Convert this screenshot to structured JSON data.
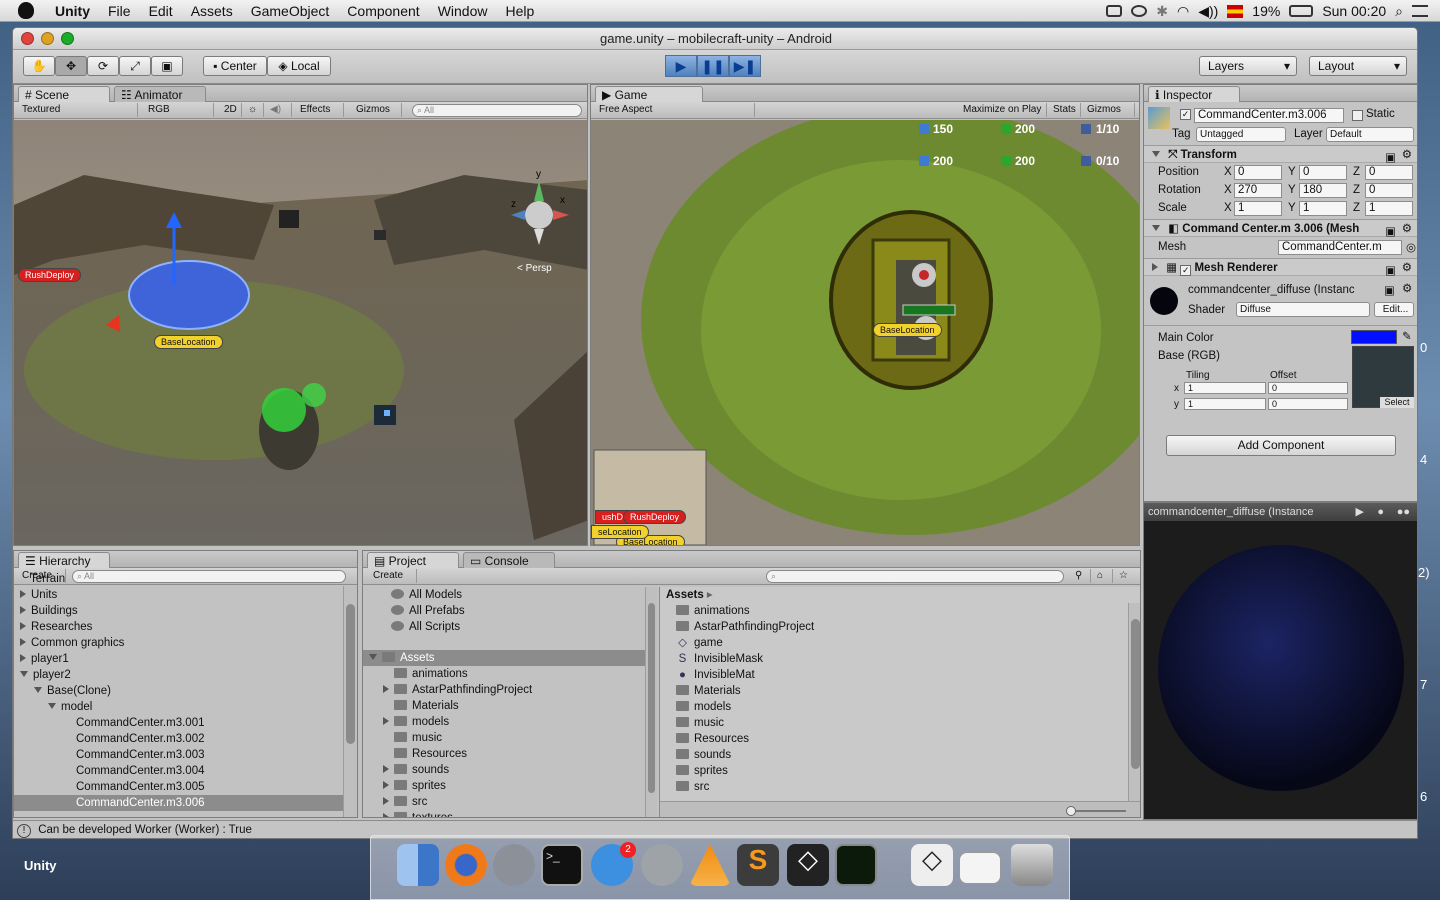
{
  "menubar": {
    "app": "Unity",
    "items": [
      "File",
      "Edit",
      "Assets",
      "GameObject",
      "Component",
      "Window",
      "Help"
    ],
    "battery": "19%",
    "clock": "Sun 00:20"
  },
  "window": {
    "title": "game.unity – mobilecraft-unity – Android"
  },
  "toolbar": {
    "center": "Center",
    "local": "Local",
    "layers": "Layers",
    "layout": "Layout"
  },
  "scene": {
    "tab": "Scene",
    "tab2": "Animator",
    "shading": "Textured",
    "mode": "RGB",
    "two_d": "2D",
    "effects": "Effects",
    "gizmos": "Gizmos",
    "search_placeholder": "All",
    "persp": "< Persp",
    "gizmo_y": "y",
    "gizmo_x": "x",
    "gizmo_z": "z",
    "label_rush": "RushDeploy",
    "label_base": "BaseLocation"
  },
  "game": {
    "tab": "Game",
    "aspect": "Free Aspect",
    "maximize": "Maximize on Play",
    "stats": "Stats",
    "gizmos": "Gizmos",
    "hud": {
      "r1a": "150",
      "r1b": "200",
      "r1c": "1/10",
      "r2a": "200",
      "r2b": "200",
      "r2c": "0/10"
    },
    "base_label": "BaseLocation",
    "mini_rush": "RushDeploy",
    "mini_rush2": "ushDe",
    "mini_base": "BaseLocation",
    "mini_base2": "seLocation"
  },
  "inspector": {
    "tab": "Inspector",
    "object": "CommandCenter.m3.006",
    "static": "Static",
    "tag_label": "Tag",
    "tag": "Untagged",
    "layer_label": "Layer",
    "layer": "Default",
    "transform": "Transform",
    "position_label": "Position",
    "rotation_label": "Rotation",
    "scale_label": "Scale",
    "position": {
      "x": "0",
      "y": "0",
      "z": "0"
    },
    "rotation": {
      "x": "270",
      "y": "180",
      "z": "0"
    },
    "scale": {
      "x": "1",
      "y": "1",
      "z": "1"
    },
    "axis_x": "X",
    "axis_y": "Y",
    "axis_z": "Z",
    "mesh_filter": "Command Center.m 3.006 (Mesh",
    "mesh_label": "Mesh",
    "mesh_value": "CommandCenter.m",
    "mesh_renderer": "Mesh Renderer",
    "material": "commandcenter_diffuse (Instanc",
    "shader_label": "Shader",
    "shader": "Diffuse",
    "edit": "Edit...",
    "main_color": "Main Color",
    "base_rgb": "Base (RGB)",
    "tiling": "Tiling",
    "offset": "Offset",
    "tx": "1",
    "ty": "1",
    "ox": "0",
    "oy": "0",
    "x_label": "x",
    "y_label": "y",
    "select": "Select",
    "add_component": "Add Component",
    "preview_title": "commandcenter_diffuse (Instance"
  },
  "hierarchy": {
    "tab": "Hierarchy",
    "create": "Create",
    "search_placeholder": "All",
    "items": [
      {
        "label": "Terrain",
        "indent": 0,
        "arrow": "none"
      },
      {
        "label": "Units",
        "indent": 0,
        "arrow": "closed"
      },
      {
        "label": "Buildings",
        "indent": 0,
        "arrow": "closed"
      },
      {
        "label": "Researches",
        "indent": 0,
        "arrow": "closed"
      },
      {
        "label": "Common graphics",
        "indent": 0,
        "arrow": "closed"
      },
      {
        "label": "player1",
        "indent": 0,
        "arrow": "closed"
      },
      {
        "label": "player2",
        "indent": 0,
        "arrow": "open"
      },
      {
        "label": "Base(Clone)",
        "indent": 1,
        "arrow": "open"
      },
      {
        "label": "model",
        "indent": 2,
        "arrow": "open"
      },
      {
        "label": "CommandCenter.m3.001",
        "indent": 3,
        "arrow": "none"
      },
      {
        "label": "CommandCenter.m3.002",
        "indent": 3,
        "arrow": "none"
      },
      {
        "label": "CommandCenter.m3.003",
        "indent": 3,
        "arrow": "none"
      },
      {
        "label": "CommandCenter.m3.004",
        "indent": 3,
        "arrow": "none"
      },
      {
        "label": "CommandCenter.m3.005",
        "indent": 3,
        "arrow": "none"
      },
      {
        "label": "CommandCenter.m3.006",
        "indent": 3,
        "arrow": "none",
        "selected": true
      }
    ]
  },
  "project": {
    "tab": "Project",
    "tab2": "Console",
    "create": "Create",
    "favorites": [
      "All Models",
      "All Prefabs",
      "All Scripts"
    ],
    "assets_root": "Assets",
    "folders": [
      {
        "label": "animations",
        "arrow": false
      },
      {
        "label": "AstarPathfindingProject",
        "arrow": true
      },
      {
        "label": "Materials",
        "arrow": false
      },
      {
        "label": "models",
        "arrow": true
      },
      {
        "label": "music",
        "arrow": false
      },
      {
        "label": "Resources",
        "arrow": false
      },
      {
        "label": "sounds",
        "arrow": true
      },
      {
        "label": "sprites",
        "arrow": true
      },
      {
        "label": "src",
        "arrow": true
      },
      {
        "label": "textures",
        "arrow": true
      }
    ],
    "breadcrumb": "Assets",
    "files": [
      "animations",
      "AstarPathfindingProject",
      "game",
      "InvisibleMask",
      "InvisibleMat",
      "Materials",
      "models",
      "music",
      "Resources",
      "sounds",
      "sprites",
      "src"
    ]
  },
  "status": {
    "message": "Can be developed Worker (Worker) : True"
  },
  "desktop": {
    "label": "Unity",
    "edge_numbers": [
      "0",
      "4",
      "2)",
      "7",
      "6"
    ]
  },
  "dock": {
    "badge": "2"
  }
}
